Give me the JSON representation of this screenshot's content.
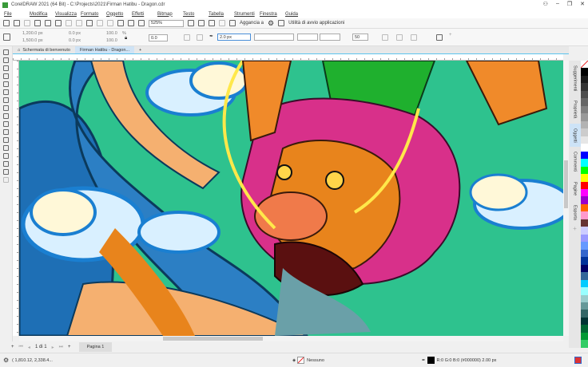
{
  "window": {
    "title": "CorelDRAW 2021 (64 Bit) - C:\\Projects\\2021\\Firman Hatibu - Dragon.cdr"
  },
  "menu": [
    "File",
    "Modifica",
    "Visualizza",
    "Formato",
    "Oggetto",
    "Effetti",
    "Bitmap",
    "Testo",
    "Tabella",
    "Strumenti",
    "Finestra",
    "Guida"
  ],
  "toolbar": {
    "zoom": "525%",
    "snap_label": "Aggancia a",
    "launcher_label": "Utilità di avvio applicazioni"
  },
  "property_bar": {
    "x": "1,200.0 px",
    "y": "1,500.0 px",
    "w": "0.0 px",
    "h": "0.0 px",
    "scale_w": "100.0",
    "scale_h": "100.0",
    "pct": "%",
    "angle": "0.0",
    "outline_width": "2.0 px",
    "miter": "50"
  },
  "tabs": [
    {
      "label": "Schermata di benvenuto"
    },
    {
      "label": "Firman Hatibu - Dragon..."
    }
  ],
  "pagebar": {
    "counter": "1 di 1",
    "page": "Pagina 1"
  },
  "dockers": [
    "Suggerimenti",
    "Proprietà",
    "Oggetti",
    "Commenti",
    "Pagine",
    "Esporta"
  ],
  "palette": [
    "#000000",
    "#1a1a1a",
    "#333333",
    "#4d4d4d",
    "#666666",
    "#808080",
    "#999999",
    "#b3b3b3",
    "#cccccc",
    "#e6e6e6",
    "#ffffff",
    "#0000ff",
    "#00ffff",
    "#00ff00",
    "#ffff00",
    "#ff0000",
    "#ff00ff",
    "#9900cc",
    "#ff6600",
    "#ff99cc",
    "#663333",
    "#ccccff",
    "#9999ff",
    "#6699ff",
    "#3366cc",
    "#003399",
    "#000066",
    "#336699",
    "#00ccff",
    "#99ffff",
    "#99cccc",
    "#669999",
    "#336666",
    "#003333",
    "#006633",
    "#009933",
    "#33cc66"
  ],
  "status": {
    "cursor": "( 1,810.12, 2,338.4...",
    "fill": "Nessuno",
    "outline": "R:0 G:0 B:0 (#000000)  2.00 px"
  },
  "colors": {
    "canvas_bg": "#2ec28e",
    "accent": "#5bc4ee"
  }
}
